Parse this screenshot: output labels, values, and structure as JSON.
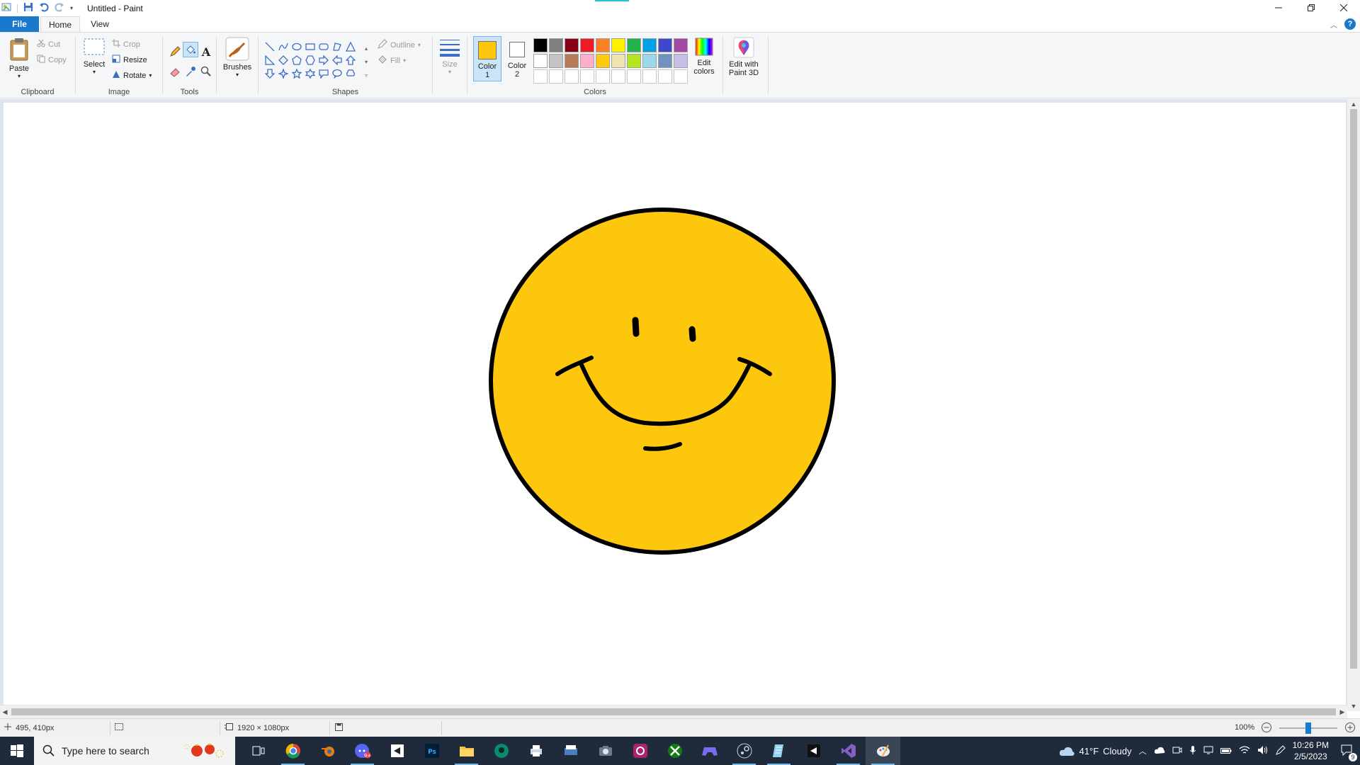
{
  "window": {
    "title": "Untitled - Paint",
    "controls": [
      "minimize",
      "restore",
      "close"
    ]
  },
  "tabs": {
    "file": "File",
    "home": "Home",
    "view": "View"
  },
  "ribbon": {
    "clipboard": {
      "label": "Clipboard",
      "paste": "Paste",
      "cut": "Cut",
      "copy": "Copy"
    },
    "image": {
      "label": "Image",
      "select": "Select",
      "crop": "Crop",
      "resize": "Resize",
      "rotate": "Rotate"
    },
    "tools": {
      "label": "Tools",
      "text_tool_glyph": "A"
    },
    "brushes": {
      "label": "Brushes"
    },
    "shapes": {
      "label": "Shapes",
      "outline": "Outline",
      "fill": "Fill"
    },
    "size": {
      "label": "Size"
    },
    "colors": {
      "label": "Colors",
      "color1_label": "Color",
      "color1_num": "1",
      "color2_label": "Color",
      "color2_num": "2",
      "color1_value": "#fdc70e",
      "color2_value": "#ffffff",
      "edit_colors": "Edit colors",
      "edit_colors_line1": "Edit",
      "edit_colors_line2": "colors",
      "palette_row1": [
        "#000000",
        "#7f7f7f",
        "#880015",
        "#ed1c24",
        "#ff7f27",
        "#fff200",
        "#22b14c",
        "#00a2e8",
        "#3f48cc",
        "#a349a4"
      ],
      "palette_row2": [
        "#ffffff",
        "#c3c3c3",
        "#b97a57",
        "#ffaec9",
        "#ffc90e",
        "#efe4b0",
        "#b5e61d",
        "#99d9ea",
        "#7092be",
        "#c8bfe7"
      ],
      "palette_row3_empty": 10
    },
    "paint3d": {
      "line1": "Edit with",
      "line2": "Paint 3D"
    }
  },
  "canvas_drawing": {
    "subject": "smiley face",
    "fill_color": "#fdc70e",
    "outline_color": "#000000"
  },
  "status": {
    "cursor_pos": "495, 410px",
    "canvas_size": "1920 × 1080px",
    "zoom": "100%"
  },
  "taskbar": {
    "search_placeholder": "Type here to search",
    "weather_temp": "41°F",
    "weather_text": "Cloudy",
    "time": "10:26 PM",
    "date": "2/5/2023",
    "notification_count": "9",
    "apps": [
      "task-view",
      "chrome",
      "blender",
      "discord",
      "unity",
      "photoshop",
      "file-explorer",
      "gitkraken",
      "printer-app",
      "scanner-app",
      "camera",
      "anydesk",
      "xbox",
      "game-controller",
      "steam",
      "notepad",
      "unity-hub",
      "visual-studio",
      "paint"
    ]
  }
}
